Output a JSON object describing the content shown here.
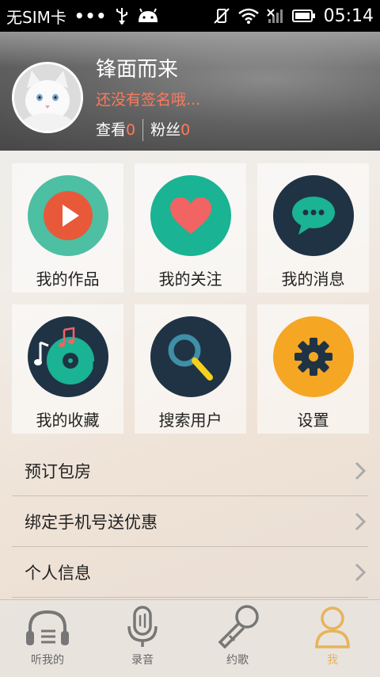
{
  "status_bar": {
    "carrier": "无SIM卡",
    "dots": "•••",
    "time": "05:14"
  },
  "profile": {
    "username": "锋面而来",
    "signature": "还没有签名哦...",
    "views_label": "查看",
    "views_count": "0",
    "fans_label": "粉丝",
    "fans_count": "0"
  },
  "grid": [
    {
      "label": "我的作品",
      "icon": "play-icon",
      "color": "#4dbfa3"
    },
    {
      "label": "我的关注",
      "icon": "heart-icon",
      "color": "#1ab394"
    },
    {
      "label": "我的消息",
      "icon": "chat-bubble-icon",
      "color": "#1f3345"
    },
    {
      "label": "我的收藏",
      "icon": "music-disc-icon",
      "color": "#1f3345"
    },
    {
      "label": "搜索用户",
      "icon": "search-icon",
      "color": "#1f3345"
    },
    {
      "label": "设置",
      "icon": "gear-icon",
      "color": "#f5a623"
    }
  ],
  "list": [
    {
      "label": "预订包房"
    },
    {
      "label": "绑定手机号送优惠"
    },
    {
      "label": "个人信息"
    }
  ],
  "tabs": [
    {
      "label": "听我的",
      "icon": "headphones-icon"
    },
    {
      "label": "录音",
      "icon": "microphone-icon"
    },
    {
      "label": "约歌",
      "icon": "karaoke-mic-icon"
    },
    {
      "label": "我",
      "icon": "person-icon",
      "active": true
    }
  ],
  "colors": {
    "accent_orange": "#ff7a5c",
    "tab_active": "#e8b35a"
  }
}
